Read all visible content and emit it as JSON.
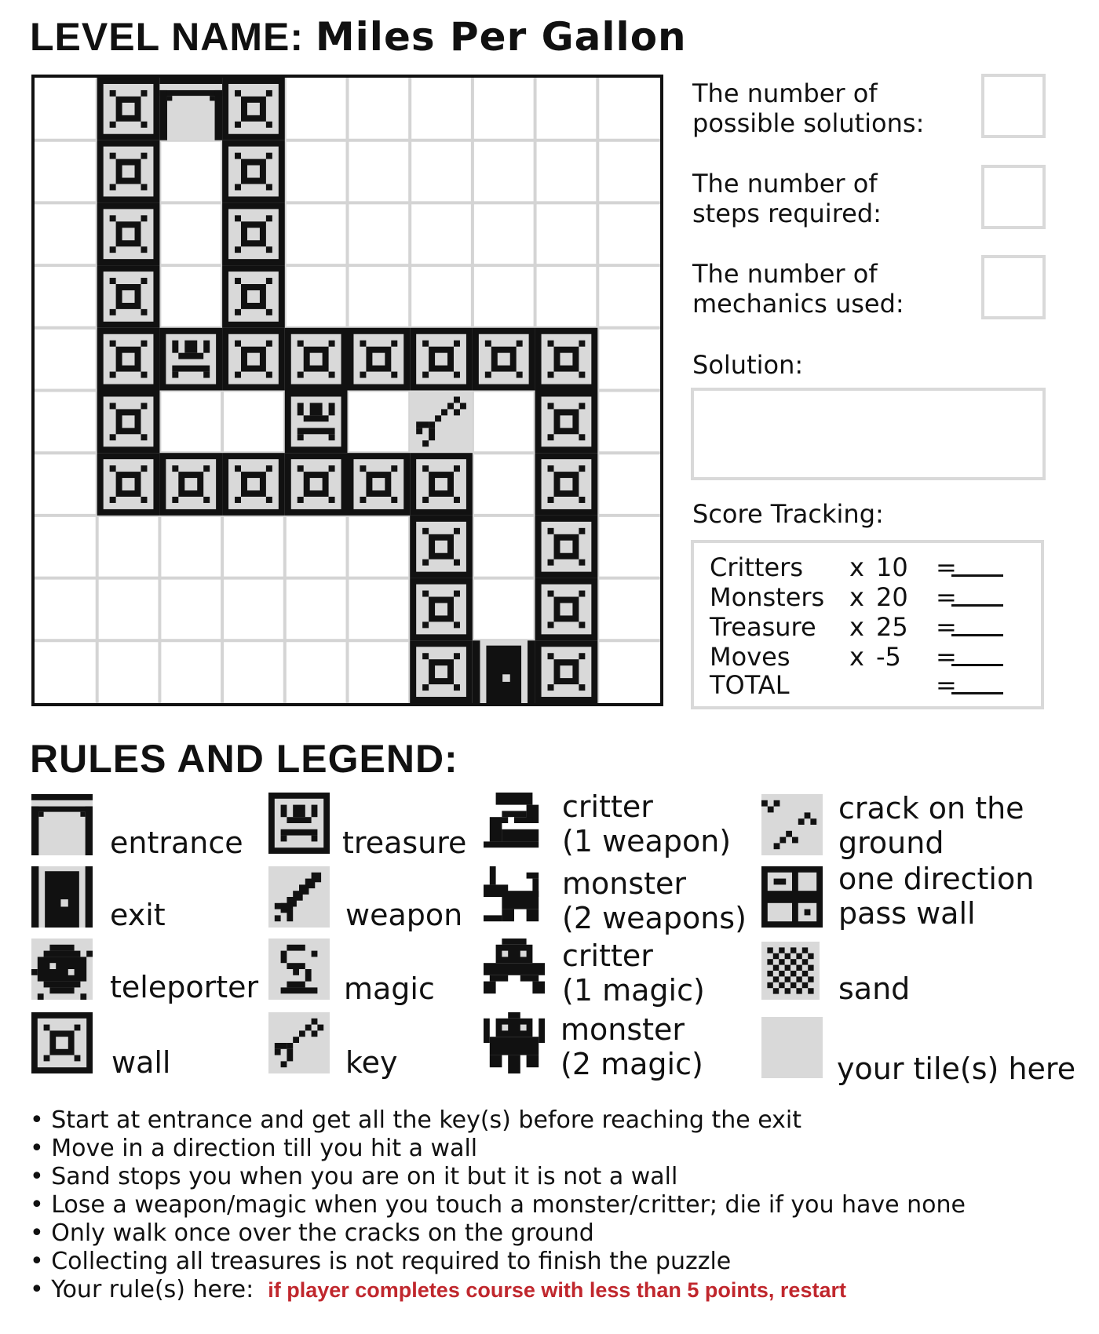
{
  "header": {
    "prefix": "LEVEL NAME:",
    "level_name": "Miles Per Gallon"
  },
  "grid": {
    "rows": 10,
    "cols": 10,
    "cells": [
      "_WEW______",
      "_W_W______",
      "_W_W______",
      "_W_W______",
      "_WTWWWWWW_",
      "_W__T_K_W_",
      "_WWWWWW_W_",
      "______W_W_",
      "______W_W_",
      "______WXW_"
    ],
    "legend_codes": {
      "_": "floor",
      "W": "wall",
      "E": "entrance",
      "X": "exit",
      "T": "treasure",
      "K": "key"
    }
  },
  "side": {
    "solutions_label": [
      "The number of",
      "possible solutions:"
    ],
    "steps_label": [
      "The number of",
      "steps required:"
    ],
    "mechanics_label": [
      "The number of",
      "mechanics used:"
    ],
    "solution_label": "Solution:",
    "score_label": "Score Tracking:"
  },
  "score": [
    {
      "name": "Critters",
      "op": "x",
      "mult": "10",
      "eq": "="
    },
    {
      "name": "Monsters",
      "op": "x",
      "mult": "20",
      "eq": "="
    },
    {
      "name": "Treasure",
      "op": "x",
      "mult": "25",
      "eq": "="
    },
    {
      "name": "Moves",
      "op": "x",
      "mult": "-5",
      "eq": "="
    },
    {
      "name": "TOTAL",
      "op": "",
      "mult": "",
      "eq": "="
    }
  ],
  "legend": {
    "title": "RULES AND LEGEND:",
    "col1": [
      "entrance",
      "exit",
      "teleporter",
      "wall"
    ],
    "col2": [
      "treasure",
      "weapon",
      "magic",
      "key"
    ],
    "col3": [
      [
        "critter",
        "(1 weapon)"
      ],
      [
        "monster",
        "(2 weapons)"
      ],
      [
        "critter",
        "(1 magic)"
      ],
      [
        "monster",
        "(2 magic)"
      ]
    ],
    "col4": [
      [
        "crack on the",
        "ground"
      ],
      [
        "one direction",
        "pass wall"
      ],
      [
        "",
        "sand"
      ],
      [
        "",
        "your tile(s) here"
      ]
    ]
  },
  "rules": {
    "items": [
      "• Start at entrance and get all the key(s) before reaching the exit",
      "• Move in a direction till you hit a wall",
      "• Sand stops you when you are on it but it is not a wall",
      "• Lose a weapon/magic when you touch a monster/critter; die if you have none",
      "• Only walk once over the cracks on the ground",
      "• Collecting all treasures is not required to finish the puzzle"
    ],
    "custom_prefix": "• Your rule(s) here:",
    "custom_rule": "if player completes course with less than 5 points, restart"
  },
  "colors": {
    "ink": "#111111",
    "tile_gray": "#d9d9d9",
    "grid_line": "#d4d4d4",
    "custom_rule": "#c0272d"
  }
}
